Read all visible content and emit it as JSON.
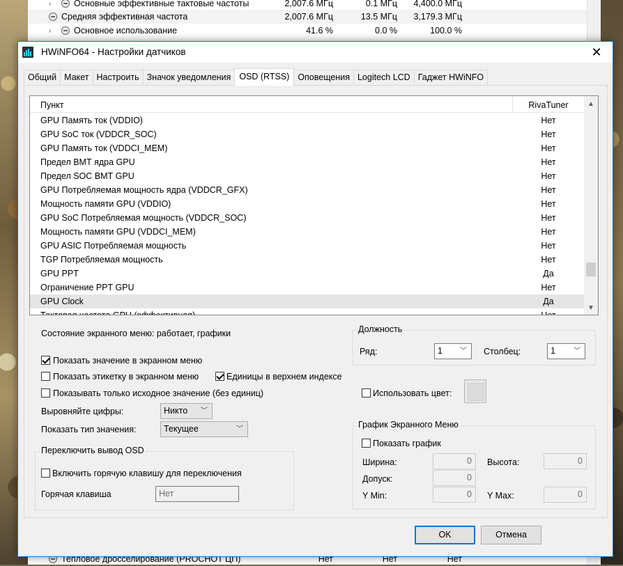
{
  "background_app": {
    "rows": [
      {
        "label": "Основные эффективные тактовые частоты",
        "c1": "2,007.6 МГц",
        "c2": "0.1 МГц",
        "c3": "4,400.0 МГц",
        "expand": "›",
        "icon": "minus-circle-icon"
      },
      {
        "label": "Средняя эффективная частота",
        "c1": "2,007.6 МГц",
        "c2": "13.5 МГц",
        "c3": "3,179.3 МГц",
        "icon": "minus-circle-icon"
      },
      {
        "label": "Основное использование",
        "c1": "41.6 %",
        "c2": "0.0 %",
        "c3": "100.0 %",
        "expand": "›",
        "icon": "minus-circle-icon"
      }
    ],
    "bottom_row": {
      "label": "Тепловое дросселирование (PROCHOT ЦП)",
      "c1": "Нет",
      "c2": "Нет",
      "c3": "Нет",
      "icon": "minus-circle-icon"
    }
  },
  "dialog": {
    "title": "HWiNFO64 - Настройки датчиков",
    "close": "✕",
    "tabs": [
      "Общий",
      "Макет",
      "Настроить",
      "Значок уведомления",
      "OSD (RTSS)",
      "Оповещения",
      "Logitech LCD",
      "Гаджет HWiNFO"
    ],
    "active_tab": "OSD (RTSS)",
    "list": {
      "col_item": "Пункт",
      "col_value": "RivaTuner",
      "rows": [
        {
          "name": "GPU Память ток (VDDIO)",
          "value": "Нет"
        },
        {
          "name": "GPU SoC ток (VDDCR_SOC)",
          "value": "Нет"
        },
        {
          "name": "GPU Память ток (VDDCI_MEM)",
          "value": "Нет"
        },
        {
          "name": "Предел ВМТ ядра GPU",
          "value": "Нет"
        },
        {
          "name": "Предел SOC ВМТ GPU",
          "value": "Нет"
        },
        {
          "name": "GPU Потребляемая мощность ядра (VDDCR_GFX)",
          "value": "Нет"
        },
        {
          "name": "Мощность памяти GPU (VDDIO)",
          "value": "Нет"
        },
        {
          "name": "GPU SoC Потребляемая мощность (VDDCR_SOC)",
          "value": "Нет"
        },
        {
          "name": "Мощность памяти GPU (VDDCI_MEM)",
          "value": "Нет"
        },
        {
          "name": "GPU ASIC Потребляемая мощность",
          "value": "Нет"
        },
        {
          "name": "TGP Потребляемая мощность",
          "value": "Нет"
        },
        {
          "name": "GPU PPT",
          "value": "Да"
        },
        {
          "name": "Ограничение PPT GPU",
          "value": "Нет"
        },
        {
          "name": "GPU Clock",
          "value": "Да"
        },
        {
          "name": "Тактовая частота GPU (эффективная)",
          "value": "Нет"
        }
      ],
      "selected_index": 13
    },
    "osd_state": "Состояние экранного меню: работает, графики",
    "show_value": {
      "label": "Показать значение в экранном меню",
      "checked": true
    },
    "show_label": {
      "label": "Показать этикетку в экранном меню",
      "checked": false
    },
    "superscript_units": {
      "label": "Единицы в верхнем индексе",
      "checked": true
    },
    "raw_value": {
      "label": "Показывать только исходное значение (без единиц)",
      "checked": false
    },
    "align_digits": {
      "label": "Выровняйте цифры:",
      "value": "Никто"
    },
    "value_type": {
      "label": "Показать тип значения:",
      "value": "Текущее"
    },
    "toggle_group": {
      "title": "Переключить вывод OSD",
      "hotkey_enable": {
        "label": "Включить горячую клавишу для переключения",
        "checked": false
      },
      "hotkey_label": "Горячая клавиша",
      "hotkey_value": "Нет"
    },
    "position_group": {
      "title": "Должность",
      "row_label": "Ряд:",
      "row_value": "1",
      "col_label": "Столбец:",
      "col_value": "1"
    },
    "use_color": {
      "label": "Использовать цвет:",
      "checked": false
    },
    "graph_group": {
      "title": "График Экранного Меню",
      "show_graph": {
        "label": "Показать график",
        "checked": false
      },
      "width_label": "Ширина:",
      "width_value": "0",
      "height_label": "Высота:",
      "height_value": "0",
      "tolerance_label": "Допуск:",
      "tolerance_value": "0",
      "ymin_label": "Y Min:",
      "ymin_value": "0",
      "ymax_label": "Y Max:",
      "ymax_value": "0"
    },
    "ok": "OK",
    "cancel": "Отмена"
  }
}
